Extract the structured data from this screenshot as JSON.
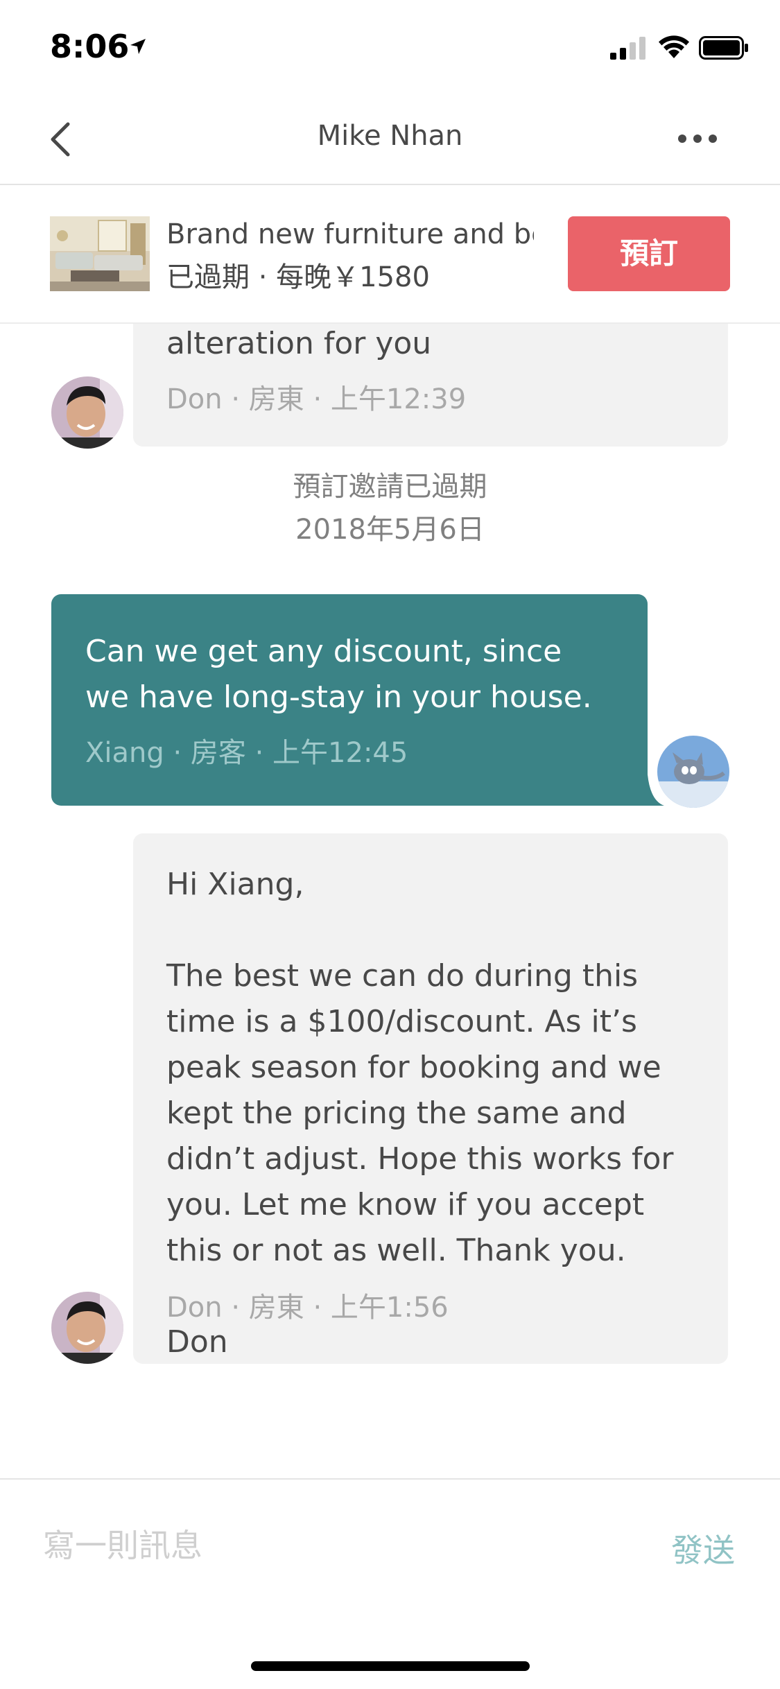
{
  "status_bar": {
    "time": "8:06"
  },
  "nav": {
    "title": "Mike Nhan",
    "back_icon": "chevron-left-icon",
    "more_icon": "more-horizontal-icon"
  },
  "listing": {
    "title": "Brand new furniture and be",
    "subtitle": "已過期 · 每晚￥1580",
    "book_label": "預訂",
    "book_color": "#ea6369"
  },
  "messages": [
    {
      "sender": "host",
      "text": "alteration for you",
      "meta": "Don · 房東 · 上午12:39"
    },
    {
      "sender": "system",
      "line1": "預訂邀請已過期",
      "line2": "2018年5月6日"
    },
    {
      "sender": "guest",
      "text": "Can we get any discount, since\nwe have long-stay in your house.",
      "meta": "Xiang · 房客 · 上午12:45",
      "bubble_color": "#3b8386"
    },
    {
      "sender": "host",
      "text": "Hi Xiang,\n\nThe best we can do during this\ntime is a $100/discount. As it’s\npeak season for booking and we\nkept the pricing the same and\ndidn’t adjust. Hope this works for\nyou. Let me know if you accept\nthis or not as well. Thank you.\n\nDon",
      "meta": "Don · 房東 · 上午1:56"
    }
  ],
  "composer": {
    "placeholder": "寫一則訊息",
    "send_label": "發送",
    "send_color": "#90c3c5"
  }
}
